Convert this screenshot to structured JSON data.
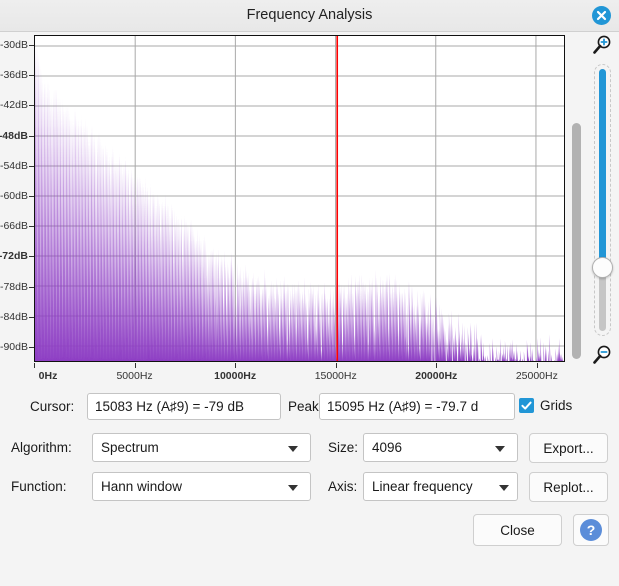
{
  "window": {
    "title": "Frequency Analysis",
    "close_icon": "close-circle-icon"
  },
  "readout": {
    "cursor_label": "Cursor:",
    "cursor_value": "15083 Hz (A♯9) = -79 dB",
    "peak_label": "Peak:",
    "peak_value": "15095 Hz (A♯9) = -79.7 d",
    "grids_label": "Grids",
    "grids_checked": true
  },
  "controls": {
    "algorithm_label": "Algorithm:",
    "algorithm_value": "Spectrum",
    "size_label": "Size:",
    "size_value": "4096",
    "export_label": "Export...",
    "function_label": "Function:",
    "function_value": "Hann window",
    "axis_label": "Axis:",
    "axis_value": "Linear frequency",
    "replot_label": "Replot...",
    "close_label": "Close",
    "help_label": "?"
  },
  "zoom_slider": {
    "zoom_in_icon": "magnifier-plus-icon",
    "zoom_out_icon": "magnifier-minus-icon",
    "accent_color": "#2196d6"
  },
  "chart_data": {
    "type": "area",
    "title": "Frequency Analysis",
    "xlabel": "",
    "ylabel": "",
    "grid": true,
    "legend": "none",
    "plot_color": "#8e3fc4",
    "cursor_line_color": "#ff0000",
    "cursor_line_x": 15083,
    "xlim": [
      0,
      26400
    ],
    "ylim": [
      -93,
      -28
    ],
    "xticks": [
      0,
      5000,
      10000,
      15000,
      20000,
      25000
    ],
    "xtick_labels": [
      "0Hz",
      "5000Hz",
      "10000Hz",
      "15000Hz",
      "20000Hz",
      "25000Hz"
    ],
    "xtick_bold": [
      true,
      false,
      true,
      false,
      true,
      false
    ],
    "yticks": [
      -30,
      -36,
      -42,
      -48,
      -54,
      -60,
      -66,
      -72,
      -78,
      -84,
      -90
    ],
    "ytick_labels": [
      "-30dB",
      "-36dB",
      "-42dB",
      "-48dB",
      "-54dB",
      "-60dB",
      "-66dB",
      "-72dB",
      "-78dB",
      "-84dB",
      "-90dB"
    ],
    "ytick_bold": [
      false,
      false,
      false,
      true,
      false,
      false,
      false,
      true,
      false,
      false,
      false
    ],
    "x": [
      0,
      110,
      220,
      330,
      440,
      550,
      660,
      770,
      880,
      990,
      1100,
      1210,
      1320,
      1430,
      1540,
      1650,
      1760,
      1870,
      1980,
      2090,
      2200,
      2310,
      2420,
      2530,
      2640,
      2750,
      2860,
      2970,
      3080,
      3190,
      3300,
      3410,
      3520,
      3630,
      3740,
      3850,
      3960,
      4070,
      4180,
      4290,
      4400,
      4510,
      4620,
      4730,
      4840,
      4950,
      5060,
      5170,
      5280,
      5390,
      5500,
      5610,
      5720,
      5830,
      5940,
      6050,
      6160,
      6270,
      6380,
      6490,
      6600,
      6710,
      6820,
      6930,
      7040,
      7150,
      7260,
      7370,
      7480,
      7590,
      7700,
      7810,
      7920,
      8030,
      8140,
      8250,
      8360,
      8470,
      8580,
      8690,
      8800,
      8910,
      9020,
      9130,
      9240,
      9350,
      9460,
      9570,
      9680,
      9790,
      9900,
      10010,
      10120,
      10230,
      10340,
      10450,
      10560,
      10670,
      10780,
      10890,
      11000,
      11110,
      11220,
      11330,
      11440,
      11550,
      11660,
      11770,
      11880,
      11990,
      12100,
      12210,
      12320,
      12430,
      12540,
      12650,
      12760,
      12870,
      12980,
      13090,
      13200,
      13310,
      13420,
      13530,
      13640,
      13750,
      13860,
      13970,
      14080,
      14190,
      14300,
      14410,
      14520,
      14630,
      14740,
      14850,
      14960,
      15070,
      15180,
      15290,
      15400,
      15510,
      15620,
      15730,
      15840,
      15950,
      16060,
      16170,
      16280,
      16390,
      16500,
      16610,
      16720,
      16830,
      16940,
      17050,
      17160,
      17270,
      17380,
      17490,
      17600,
      17710,
      17820,
      17930,
      18040,
      18150,
      18260,
      18370,
      18480,
      18590,
      18700,
      18810,
      18920,
      19030,
      19140,
      19250,
      19360,
      19470,
      19580,
      19690,
      19800,
      19910,
      20020,
      20130,
      20240,
      20350,
      20460,
      20570,
      20680,
      20790,
      20900,
      21010,
      21120,
      21230,
      21340,
      21450,
      21560,
      21670,
      21780,
      21890,
      22000,
      22110,
      22220,
      22330,
      22440,
      22550
    ],
    "values_db": [
      -29.5,
      -30.2,
      -33.5,
      -36.0,
      -37.2,
      -37.0,
      -36.6,
      -38.8,
      -41.0,
      -38.2,
      -39.5,
      -41.8,
      -40.2,
      -42.5,
      -43.0,
      -41.5,
      -44.0,
      -45.2,
      -42.8,
      -44.5,
      -46.0,
      -44.2,
      -46.8,
      -45.0,
      -47.5,
      -48.2,
      -46.5,
      -48.8,
      -50.0,
      -47.8,
      -49.5,
      -51.2,
      -49.0,
      -51.5,
      -52.8,
      -50.5,
      -52.2,
      -54.0,
      -51.8,
      -53.5,
      -55.0,
      -52.5,
      -54.8,
      -56.2,
      -54.0,
      -56.5,
      -57.8,
      -55.5,
      -57.2,
      -59.0,
      -56.8,
      -58.5,
      -60.2,
      -58.0,
      -60.5,
      -61.8,
      -59.5,
      -61.2,
      -63.0,
      -60.8,
      -62.5,
      -64.2,
      -62.0,
      -64.5,
      -65.8,
      -63.5,
      -65.2,
      -67.0,
      -64.8,
      -66.5,
      -68.2,
      -66.0,
      -68.5,
      -69.8,
      -67.5,
      -69.2,
      -71.0,
      -68.8,
      -70.5,
      -72.2,
      -70.0,
      -72.5,
      -73.5,
      -71.5,
      -73.0,
      -74.5,
      -72.5,
      -74.2,
      -75.5,
      -73.5,
      -75.0,
      -76.2,
      -74.5,
      -76.0,
      -77.0,
      -75.5,
      -76.8,
      -77.5,
      -76.0,
      -77.2,
      -78.0,
      -76.5,
      -77.8,
      -78.5,
      -77.0,
      -78.2,
      -79.0,
      -77.5,
      -78.8,
      -79.5,
      -78.0,
      -79.2,
      -80.0,
      -78.5,
      -79.5,
      -80.2,
      -78.8,
      -79.8,
      -80.5,
      -79.0,
      -80.0,
      -80.8,
      -79.2,
      -80.2,
      -81.0,
      -79.5,
      -80.5,
      -81.2,
      -79.8,
      -80.8,
      -81.5,
      -80.0,
      -79.5,
      -80.8,
      -79.0,
      -79.8,
      -80.5,
      -78.8,
      -79.5,
      -80.2,
      -78.5,
      -79.2,
      -80.0,
      -78.2,
      -79.0,
      -79.8,
      -78.0,
      -78.8,
      -79.5,
      -77.8,
      -78.5,
      -79.2,
      -77.5,
      -78.2,
      -79.0,
      -77.8,
      -78.5,
      -79.2,
      -78.0,
      -78.8,
      -79.5,
      -78.5,
      -79.2,
      -80.0,
      -79.0,
      -79.8,
      -80.5,
      -79.5,
      -80.5,
      -81.2,
      -80.2,
      -81.0,
      -82.0,
      -81.0,
      -82.0,
      -83.0,
      -82.0,
      -83.2,
      -84.0,
      -83.0,
      -84.0,
      -85.0,
      -84.0,
      -85.2,
      -86.0,
      -85.0,
      -86.0,
      -87.0,
      -86.0,
      -86.8,
      -87.5,
      -86.5,
      -87.5,
      -88.2,
      -87.0,
      -88.0,
      -89.0,
      -88.0,
      -89.0,
      -90.0,
      -89.0,
      -90.5,
      -91.5,
      -91.0,
      -92.0,
      -93.0,
      -93.0,
      -93.0
    ]
  }
}
